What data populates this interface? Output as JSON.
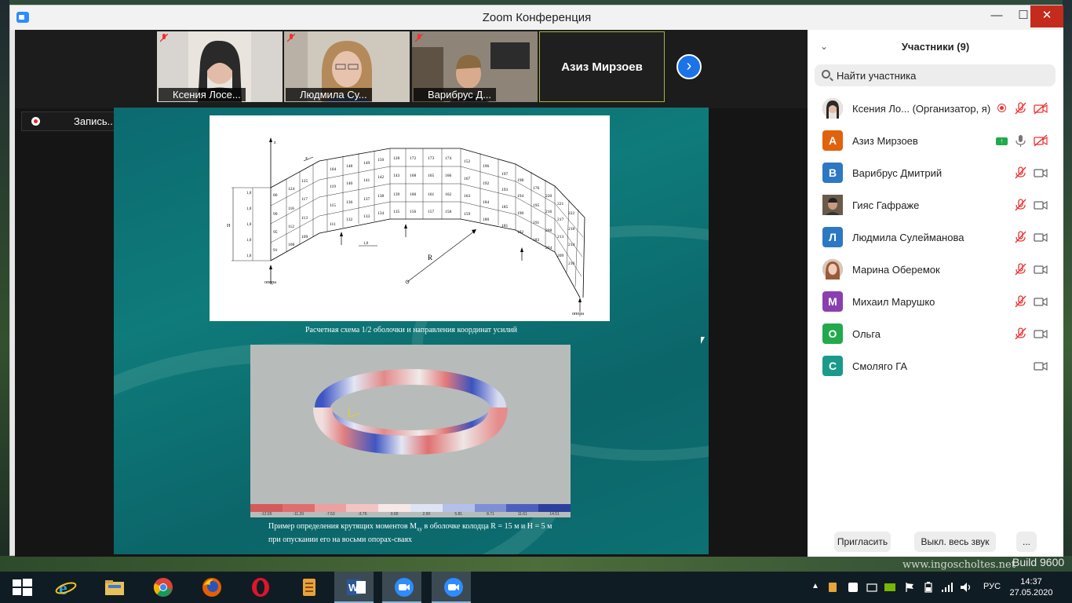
{
  "desktop": {
    "watermark": "www.ingoscholtes.net",
    "build": "Build 9600"
  },
  "window": {
    "title": "Zoom Конференция",
    "minimize": "—",
    "maximize": "☐",
    "close": "✕"
  },
  "video_strip": {
    "tiles": [
      {
        "label": "Ксения Лосе..."
      },
      {
        "label": "Людмила Су..."
      },
      {
        "label": "Варибрус Д..."
      },
      {
        "label": "Азиз Мирзоев"
      }
    ],
    "next": "›"
  },
  "recording": {
    "label": "Запись..."
  },
  "slide": {
    "diagram": {
      "z_axis": "z",
      "x_axis": "x",
      "h_label": "H",
      "r_label": "R",
      "spacing": "1,0",
      "support_left": "опора",
      "support_right": "опора",
      "side_ticks": [
        "1,0",
        "1,0",
        "1,0",
        "1,0",
        "1,0"
      ]
    },
    "caption_top": "Расчетная схема 1/2 оболочки и направления координат усилий",
    "legend_values": [
      "-12.65",
      "-11.29",
      "-7.53",
      "-3.76",
      "0.00",
      "2.90",
      "5.81",
      "8.71",
      "11.61",
      "14.51"
    ],
    "legend_colors": [
      "#d45a5a",
      "#e06e6e",
      "#eca0a0",
      "#f3c4c4",
      "#f7e8e8",
      "#dfe4f5",
      "#b4c0ea",
      "#7f8fd6",
      "#4d5fbe",
      "#2b3f9e"
    ],
    "caption_bottom_1": "Пример определения крутящих моментов M",
    "caption_bottom_sub": "xy",
    "caption_bottom_2": " в оболочке колодца R = 15 м и H = 5 м при опускании его на восьми опорах-сваях"
  },
  "panel": {
    "title": "Участники (9)",
    "search_placeholder": "Найти участника",
    "participants": [
      {
        "name": "Ксения Ло...  (Организатор, я)",
        "avatar": "",
        "color": "#8a6a5a"
      },
      {
        "name": "Азиз Мирзоев",
        "avatar": "А",
        "color": "#e0620d"
      },
      {
        "name": "Варибрус Дмитрий",
        "avatar": "В",
        "color": "#2d78c2"
      },
      {
        "name": "Гияс Гафраже",
        "avatar": "",
        "color": "#5a4a3a"
      },
      {
        "name": "Людмила Сулейманова",
        "avatar": "Л",
        "color": "#2d78c2"
      },
      {
        "name": "Марина Оберемок",
        "avatar": "",
        "color": "#b07a6a"
      },
      {
        "name": "Михаил Марушко",
        "avatar": "М",
        "color": "#8a3fb0"
      },
      {
        "name": "Ольга",
        "avatar": "О",
        "color": "#21a94c"
      },
      {
        "name": "Смоляго ГА",
        "avatar": "С",
        "color": "#1a9a8a"
      }
    ],
    "invite": "Пригласить",
    "mute_all": "Выкл. весь звук",
    "more": "..."
  },
  "taskbar": {
    "lang": "РУС",
    "time": "14:37",
    "date": "27.05.2020"
  }
}
